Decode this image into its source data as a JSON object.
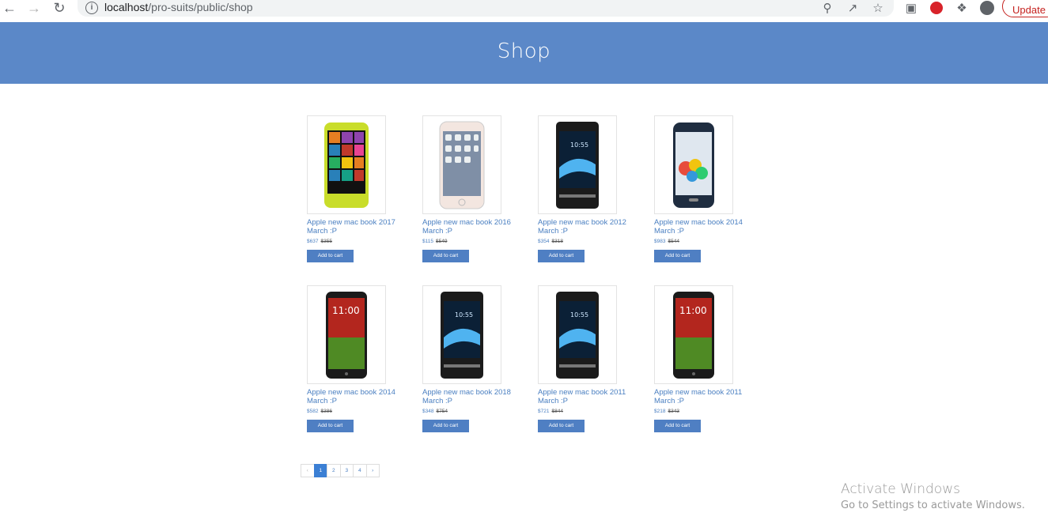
{
  "browser": {
    "url_host": "localhost",
    "url_path": "/pro-suits/public/shop",
    "update_label": "Update"
  },
  "banner": {
    "title": "Shop"
  },
  "products": [
    {
      "title": "Apple new mac book 2017 March :P",
      "price": "$637",
      "old_price": "$355",
      "phone": "lumia",
      "cart_label": "Add to cart"
    },
    {
      "title": "Apple new mac book 2016 March :P",
      "price": "$115",
      "old_price": "$549",
      "phone": "iphone",
      "cart_label": "Add to cart"
    },
    {
      "title": "Apple new mac book 2012 March :P",
      "price": "$354",
      "old_price": "$318",
      "phone": "xperia",
      "cart_label": "Add to cart"
    },
    {
      "title": "Apple new mac book 2014 March :P",
      "price": "$983",
      "old_price": "$544",
      "phone": "galaxy",
      "cart_label": "Add to cart"
    },
    {
      "title": "Apple new mac book 2014 March :P",
      "price": "$582",
      "old_price": "$386",
      "phone": "lg",
      "cart_label": "Add to cart"
    },
    {
      "title": "Apple new mac book 2018 March :P",
      "price": "$348",
      "old_price": "$754",
      "phone": "xperia",
      "cart_label": "Add to cart"
    },
    {
      "title": "Apple new mac book 2011 March :P",
      "price": "$721",
      "old_price": "$844",
      "phone": "xperia",
      "cart_label": "Add to cart"
    },
    {
      "title": "Apple new mac book 2011 March :P",
      "price": "$218",
      "old_price": "$343",
      "phone": "lg",
      "cart_label": "Add to cart"
    }
  ],
  "pagination": {
    "prev": "‹",
    "pages": [
      "1",
      "2",
      "3",
      "4"
    ],
    "next": "›",
    "current": "1"
  },
  "watermark": {
    "line1": "Activate Windows",
    "line2": "Go to Settings to activate Windows."
  }
}
